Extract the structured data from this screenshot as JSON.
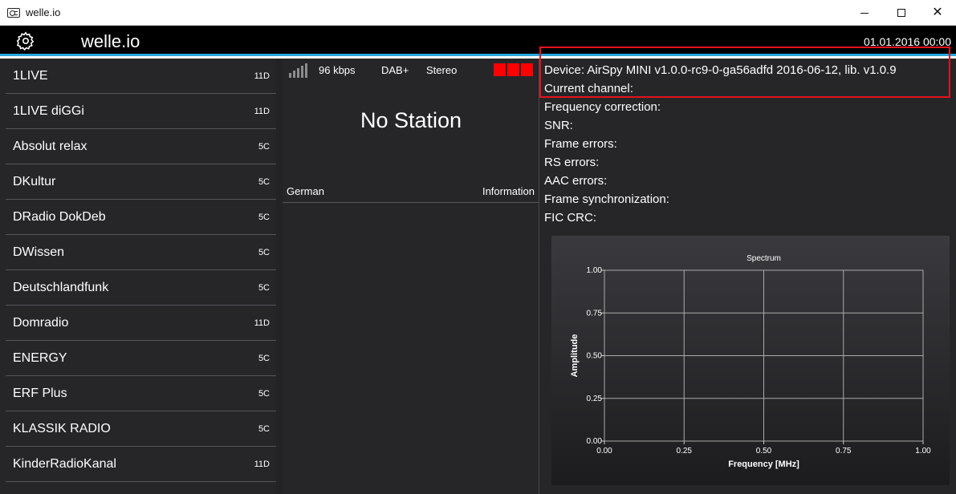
{
  "window": {
    "title": "welle.io",
    "icon": "radio-icon",
    "controls": {
      "minimize": "minimize-icon",
      "maximize": "maximize-icon",
      "close": "close-icon"
    }
  },
  "header": {
    "settings_icon": "gear-icon",
    "title": "welle.io",
    "datetime": "01.01.2016 00:00",
    "accent_color": "#2aa6dc"
  },
  "stations": [
    {
      "name": "1LIVE",
      "channel": "11D"
    },
    {
      "name": "1LIVE diGGi",
      "channel": "11D"
    },
    {
      "name": "Absolut relax",
      "channel": "5C"
    },
    {
      "name": "DKultur",
      "channel": "5C"
    },
    {
      "name": "DRadio DokDeb",
      "channel": "5C"
    },
    {
      "name": "DWissen",
      "channel": "5C"
    },
    {
      "name": "Deutschlandfunk",
      "channel": "5C"
    },
    {
      "name": "Domradio",
      "channel": "11D"
    },
    {
      "name": "ENERGY",
      "channel": "5C"
    },
    {
      "name": "ERF Plus",
      "channel": "5C"
    },
    {
      "name": "KLASSIK RADIO",
      "channel": "5C"
    },
    {
      "name": "KinderRadioKanal",
      "channel": "11D"
    }
  ],
  "player": {
    "signal_icon": "signal-strength-icon",
    "bitrate": "96 kbps",
    "dab_type": "DAB+",
    "audio_mode": "Stereo",
    "status_indicator_color": "#ff0000",
    "station_name": "No Station",
    "language": "German",
    "info_label": "Information"
  },
  "info": {
    "device": "Device: AirSpy MINI v1.0.0-rc9-0-ga56adfd 2016-06-12, lib. v1.0.9",
    "current_channel": "Current channel:",
    "frequency_correction": "Frequency correction:",
    "snr": "SNR:",
    "frame_errors": "Frame errors:",
    "rs_errors": "RS errors:",
    "aac_errors": "AAC errors:",
    "frame_sync": "Frame synchronization:",
    "fic_crc": "FIC CRC:",
    "highlight_color": "#e8111e"
  },
  "chart_data": {
    "type": "line",
    "title": "Spectrum",
    "xlabel": "Frequency [MHz]",
    "ylabel": "Amplitude",
    "xlim": [
      0,
      1
    ],
    "ylim": [
      0,
      1
    ],
    "x_ticks": [
      "0.00",
      "0.25",
      "0.50",
      "0.75",
      "1.00"
    ],
    "y_ticks": [
      "0.00",
      "0.25",
      "0.50",
      "0.75",
      "1.00"
    ],
    "grid": true,
    "series": []
  }
}
